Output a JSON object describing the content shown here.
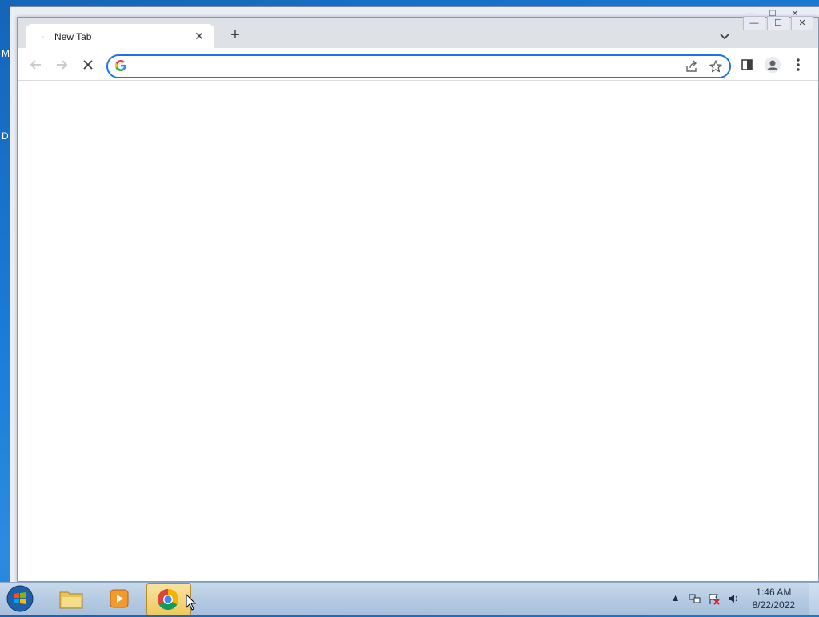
{
  "desktop": {
    "left_fragments": [
      "M",
      "D"
    ]
  },
  "back_window": {
    "controls": [
      "—",
      "☐",
      "✕"
    ]
  },
  "browser": {
    "tab": {
      "title": "New Tab",
      "close_icon": "close-icon"
    },
    "new_tab_label": "+",
    "window_controls": [
      "—",
      "☐",
      "✕"
    ],
    "toolbar": {
      "back": "back-arrow-icon",
      "forward": "forward-arrow-icon",
      "stop": "stop-loading-icon"
    },
    "omnibox": {
      "value": "",
      "placeholder": ""
    },
    "accent_color": "#1a73e8"
  },
  "taskbar": {
    "apps": [
      "windows-explorer",
      "media-player",
      "google-chrome"
    ],
    "active_app": "google-chrome",
    "tray_arrow": "▲",
    "clock": {
      "time": "1:46 AM",
      "date": "8/22/2022"
    }
  }
}
